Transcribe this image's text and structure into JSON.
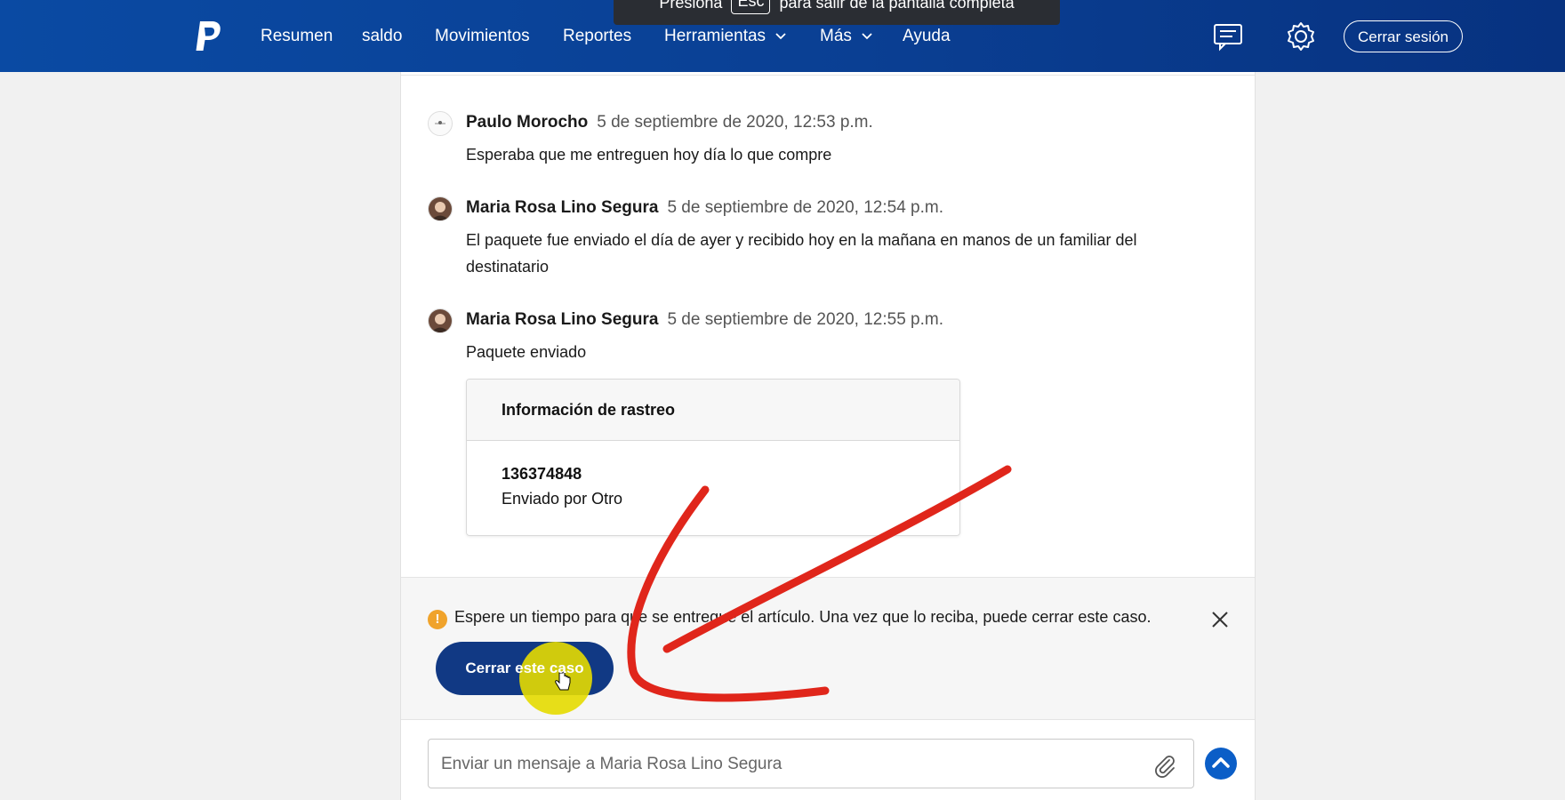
{
  "nav": {
    "items": [
      {
        "label": "Resumen"
      },
      {
        "label": "saldo"
      },
      {
        "label": "Movimientos"
      },
      {
        "label": "Reportes"
      },
      {
        "label": "Herramientas"
      },
      {
        "label": "Más"
      },
      {
        "label": "Ayuda"
      }
    ],
    "logout_label": "Cerrar sesión",
    "icons": {
      "logo": "paypal-logo",
      "messages": "messages-icon",
      "settings": "gear-icon"
    }
  },
  "fullscreen_toast": {
    "before": "Presiona",
    "key": "Esc",
    "after": "para salir de la pantalla completa"
  },
  "messages": [
    {
      "name": "Paulo Morocho",
      "time": "5 de septiembre de 2020, 12:53 p.m.",
      "text": "Esperaba que me entreguen hoy día lo que compre"
    },
    {
      "name": "Maria Rosa Lino Segura",
      "time": "5 de septiembre de 2020, 12:54 p.m.",
      "text": "El paquete fue enviado el día de ayer y recibido hoy en la mañana en manos de un familiar del destinatario"
    },
    {
      "name": "Maria Rosa Lino Segura",
      "time": "5 de septiembre de 2020, 12:55 p.m.",
      "text": "Paquete enviado"
    }
  ],
  "tracking": {
    "title": "Información de rastreo",
    "number": "136374848",
    "carrier": "Enviado por Otro"
  },
  "banner": {
    "text": "Espere un tiempo para que se entregue el artículo. Una vez que lo reciba, puede cerrar este caso.",
    "button_label": "Cerrar este caso"
  },
  "composer": {
    "placeholder": "Enviar un mensaje a Maria Rosa Lino Segura"
  },
  "colors": {
    "nav_bg": "#0a4aa3",
    "primary_button": "#113984",
    "send_button": "#0b5ec7",
    "warning": "#f0a32b",
    "annotation": "#e0261b",
    "highlight": "#e6dc00"
  }
}
